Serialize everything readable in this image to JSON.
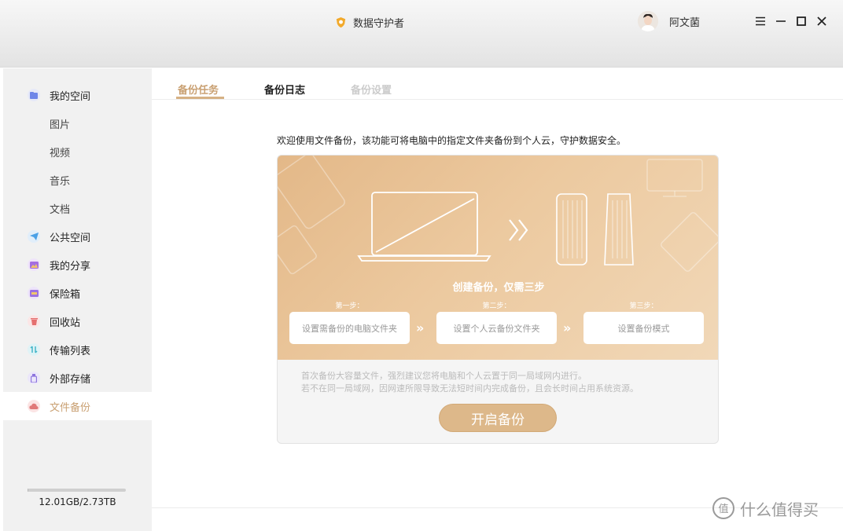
{
  "app": {
    "title": "数据守护者"
  },
  "user": {
    "name": "阿文菌"
  },
  "sidebar": {
    "items": [
      {
        "label": "我的空间",
        "icon": "folder-icon",
        "color": "#6f86e8",
        "sub": false
      },
      {
        "label": "图片",
        "sub": true
      },
      {
        "label": "视频",
        "sub": true
      },
      {
        "label": "音乐",
        "sub": true
      },
      {
        "label": "文档",
        "sub": true
      },
      {
        "label": "公共空间",
        "icon": "send-icon",
        "color": "#4aa0e6",
        "sub": false
      },
      {
        "label": "我的分享",
        "icon": "image-icon",
        "color": "#a46fe0",
        "sub": false
      },
      {
        "label": "保险箱",
        "icon": "safe-icon",
        "color": "#9c72e0",
        "sub": false
      },
      {
        "label": "回收站",
        "icon": "trash-icon",
        "color": "#e56f6f",
        "sub": false
      },
      {
        "label": "传输列表",
        "icon": "transfer-icon",
        "color": "#45b6c9",
        "sub": false
      },
      {
        "label": "外部存储",
        "icon": "usb-icon",
        "color": "#8d74dd",
        "sub": false
      },
      {
        "label": "文件备份",
        "icon": "cloud-backup-icon",
        "color": "#e07878",
        "sub": false,
        "active": true
      }
    ],
    "storage": {
      "text": "12.01GB/2.73TB",
      "fraction": 0.004
    }
  },
  "tabs": [
    {
      "label": "备份任务",
      "state": "active",
      "color": "#c9a072"
    },
    {
      "label": "备份日志",
      "state": "normal",
      "color": "#222222"
    },
    {
      "label": "备份设置",
      "state": "disabled",
      "color": "#cccccc"
    }
  ],
  "main": {
    "intro": "欢迎使用文件备份，该功能可将电脑中的指定文件夹备份到个人云，守护数据安全。",
    "steps_title": "创建备份，仅需三步",
    "steps": [
      {
        "caption": "第一步：",
        "label": "设置需备份的电脑文件夹"
      },
      {
        "caption": "第二步：",
        "label": "设置个人云备份文件夹"
      },
      {
        "caption": "第三步：",
        "label": "设置备份模式"
      }
    ],
    "notes": [
      "首次备份大容量文件，强烈建议您将电脑和个人云置于同一局域网内进行。",
      "若不在同一局域网，因网速所限导致无法短时间内完成备份，且会长时间占用系统资源。"
    ],
    "start_button": "开启备份"
  },
  "watermark": {
    "text": "什么值得买",
    "badge": "值"
  },
  "colors": {
    "accent": "#d6b184",
    "button": "#ddb88a"
  }
}
